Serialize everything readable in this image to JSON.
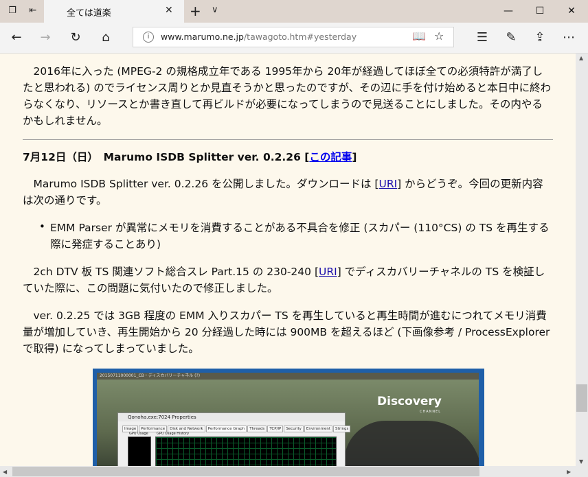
{
  "tab": {
    "title": "全ては道楽"
  },
  "address": {
    "domain": "www.marumo.ne.jp",
    "path": "/tawagoto.htm#yesterday"
  },
  "content": {
    "intro": "　2016年に入った (MPEG-2 の規格成立年である 1995年から 20年が経過してほぼ全ての必須特許が満了したと思われる) のでライセンス周りとか見直そうかと思ったのですが、その辺に手を付け始めると本日中に終わらなくなり、リソースとか書き直して再ビルドが必要になってしまうので見送ることにしました。その内やるかもしれません。",
    "heading": "7月12日（日）　Marumo ISDB Splitter ver. 0.2.26 [",
    "heading_link": "この記事",
    "heading_end": "]",
    "p1_a": "　Marumo ISDB Splitter ver. 0.2.26 を公開しました。ダウンロードは [",
    "p1_link": "URI",
    "p1_b": "] からどうぞ。今回の更新内容は次の通りです。",
    "bullet_mark": "•",
    "bullet": "EMM Parser が異常にメモリを消費することがある不具合を修正 (スカパー (110°CS) の TS を再生する際に発症することあり)",
    "p2_a": "　2ch DTV 板 TS 関連ソフト総合スレ Part.15 の 230-240 [",
    "p2_link": "URI",
    "p2_b": "] でディスカバリーチャネルの TS を検証していた際に、この問題に気付いたので修正しました。",
    "p3": "　ver. 0.2.25 では 3GB 程度の EMM 入りスカパー TS を再生していると再生時間が進むにつれてメモリ消費量が増加していき、再生開始から 20 分経過した時には 900MB を超えるほど (下画像参考 / ProcessExplorer で取得) になってしまっていました。"
  },
  "screenshot": {
    "window_title": "20150711000001_CB・ディスカバリーチャネル (?)",
    "logo": "Discovery",
    "logo_sub": "CHANNEL",
    "pe_title": "Qonoha.exe:7024 Properties",
    "pe_tabs": [
      "Image",
      "Performance",
      "Disk and Network",
      "Performance Graph",
      "Threads",
      "TCP/IP",
      "Security",
      "Environment",
      "Strings"
    ],
    "pe_label1": "GPU Usage",
    "pe_label2": "GPU Usage History"
  },
  "colors": {
    "content_bg": "#fdf8ec",
    "titlebar": "#dfd6cf",
    "link": "#1a0dab"
  }
}
